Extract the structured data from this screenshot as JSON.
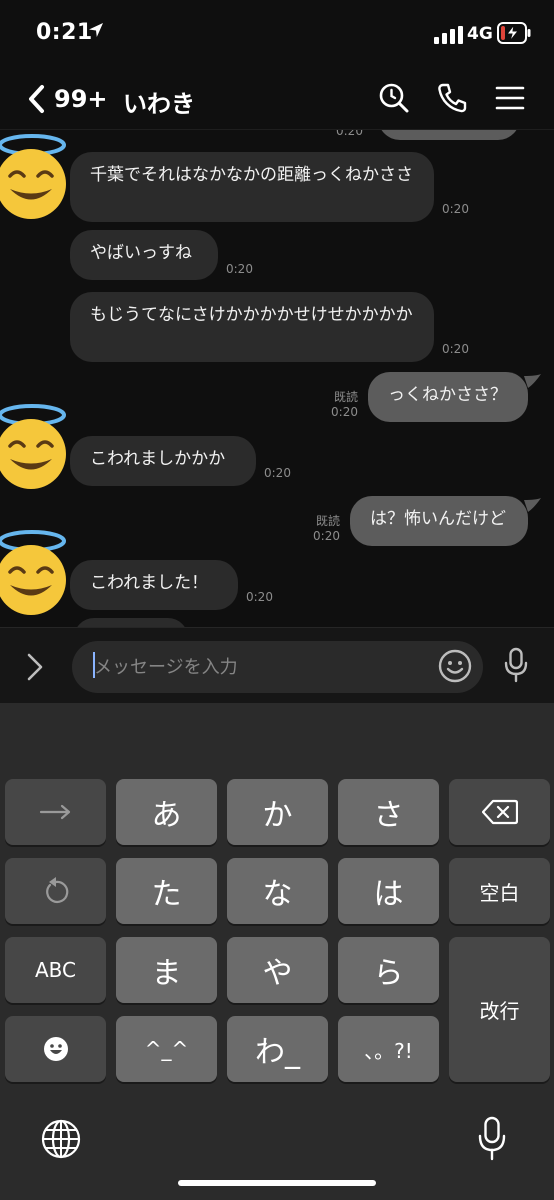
{
  "status": {
    "time": "0:21",
    "network": "4G"
  },
  "header": {
    "back_count": "99+",
    "title": "いわき"
  },
  "messages": [
    {
      "text": "千葉でそれはなかなかの距離っくねかささ",
      "time": "0:20"
    },
    {
      "text": "やばいっすね",
      "time": "0:20"
    },
    {
      "text": "もじうてなにさけかかかかせけせかかかか",
      "time": "0:20"
    },
    {
      "text": "っくねかささ？",
      "time": "0:20",
      "read": "既読"
    },
    {
      "text": "こわれましかかか",
      "time": "0:20"
    },
    {
      "text": "は？怖いんだけど",
      "time": "0:20",
      "read": "既読"
    },
    {
      "text": "こわれました！",
      "time": "0:20"
    }
  ],
  "input": {
    "placeholder": "メッセージを入力"
  },
  "keyboard": {
    "keys": [
      "あ",
      "か",
      "さ",
      "た",
      "な",
      "は",
      "ま",
      "や",
      "ら",
      "^_^",
      "わ_",
      "、。?!"
    ],
    "abc": "ABC",
    "space": "空白",
    "return": "改行",
    "icons": [
      "arrow-right-icon",
      "delete-icon",
      "undo-icon",
      "emoji-icon",
      "globe-icon",
      "mic-icon"
    ]
  },
  "colors": {
    "background": "#0f0f0f",
    "bubble_in": "#2b2b2b",
    "bubble_out": "#5c5c5c",
    "keyboard_bg": "#2b2b2b",
    "key_light": "#6b6b6b",
    "key_dark": "#474747",
    "battery_low": "#e0453a"
  }
}
